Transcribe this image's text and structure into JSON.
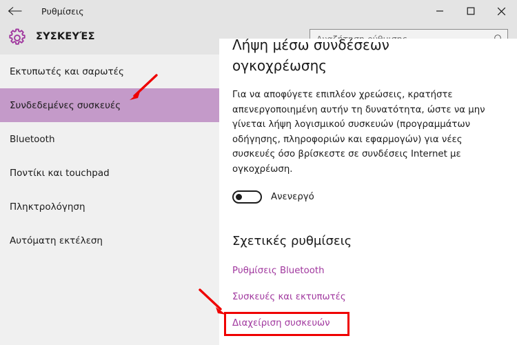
{
  "window": {
    "title": "Ρυθμίσεις",
    "back_icon": "back-arrow-icon",
    "minimize_label": "—",
    "maximize_label": "□",
    "close_label": "✕"
  },
  "header": {
    "icon": "gear-icon",
    "title": "ΣΥΣΚΕΥΈΣ",
    "accent_color": "#a0379e"
  },
  "search": {
    "placeholder": "Αναζήτηση ρύθμισης",
    "value": "",
    "icon": "search-icon"
  },
  "sidebar": {
    "background": "#f0f0f0",
    "selected_color": "#c49ac9",
    "items": [
      {
        "label": "Εκτυπωτές και σαρωτές",
        "selected": false
      },
      {
        "label": "Συνδεδεμένες συσκευές",
        "selected": true
      },
      {
        "label": "Bluetooth",
        "selected": false
      },
      {
        "label": "Ποντίκι και touchpad",
        "selected": false
      },
      {
        "label": "Πληκτρολόγηση",
        "selected": false
      },
      {
        "label": "Αυτόματη εκτέλεση",
        "selected": false
      }
    ]
  },
  "main": {
    "heading_line1": "Λήψη μέσω συνδέσεων",
    "heading_line2": "ογκοχρέωσης",
    "body": "Για να αποφύγετε επιπλέον χρεώσεις, κρατήστε απενεργοποιημένη αυτήν τη δυνατότητα, ώστε να μην γίνεται λήψη λογισμικού συσκευών (προγραμμάτων οδήγησης, πληροφοριών και εφαρμογών) για νέες συσκευές όσο βρίσκεστε σε συνδέσεις Internet με ογκοχρέωση.",
    "toggle": {
      "state_label": "Ανενεργό",
      "on": false
    },
    "related_title": "Σχετικές ρυθμίσεις",
    "links": [
      {
        "label": "Ρυθμίσεις Bluetooth",
        "highlighted": false
      },
      {
        "label": "Συσκευές και εκτυπωτές",
        "highlighted": false
      },
      {
        "label": "Διαχείριση συσκευών",
        "highlighted": true
      }
    ],
    "link_color": "#a0379e"
  },
  "annotations": {
    "highlight_color": "#ef0000",
    "arrows": [
      {
        "name": "arrow-pointing-to-selected-sidebar-item",
        "direction": "down-left"
      },
      {
        "name": "arrow-pointing-to-manage-devices-link",
        "direction": "down-right"
      }
    ]
  }
}
